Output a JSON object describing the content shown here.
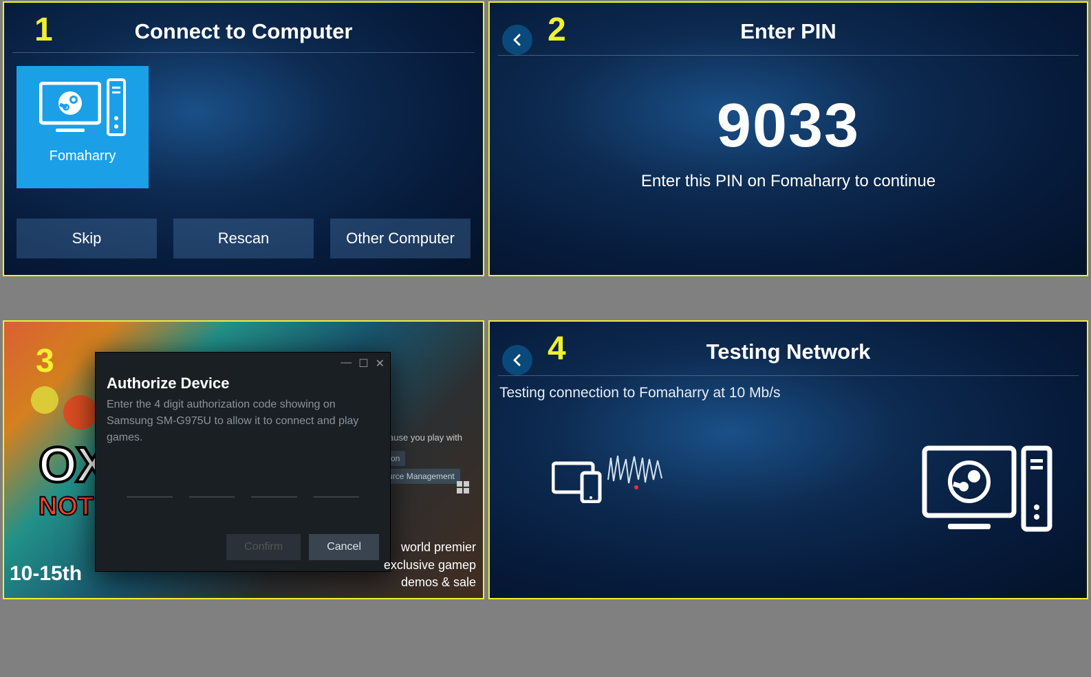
{
  "panel1": {
    "step": "1",
    "title": "Connect to Computer",
    "computer_name": "Fomaharry",
    "buttons": {
      "skip": "Skip",
      "rescan": "Rescan",
      "other": "Other Computer"
    }
  },
  "panel2": {
    "step": "2",
    "title": "Enter PIN",
    "pin": "9033",
    "instruction": "Enter this PIN on Fomaharry to continue"
  },
  "panel3": {
    "step": "3",
    "game_title_line1": "OX",
    "game_title_line2": "NOT",
    "tag_intro": "because you play with",
    "tags": {
      "t1": "mulation",
      "t2": "Resource Management"
    },
    "dialog": {
      "title": "Authorize Device",
      "body": "Enter the 4 digit authorization code showing on Samsung SM-G975U to allow it to connect and play games.",
      "confirm": "Confirm",
      "cancel": "Cancel"
    },
    "footer": {
      "l1": "world premier",
      "l2": "exclusive gamep",
      "l3": "demos & sale"
    },
    "date": "10-15th"
  },
  "panel4": {
    "step": "4",
    "title": "Testing Network",
    "status": "Testing connection to Fomaharry at 10 Mb/s"
  }
}
